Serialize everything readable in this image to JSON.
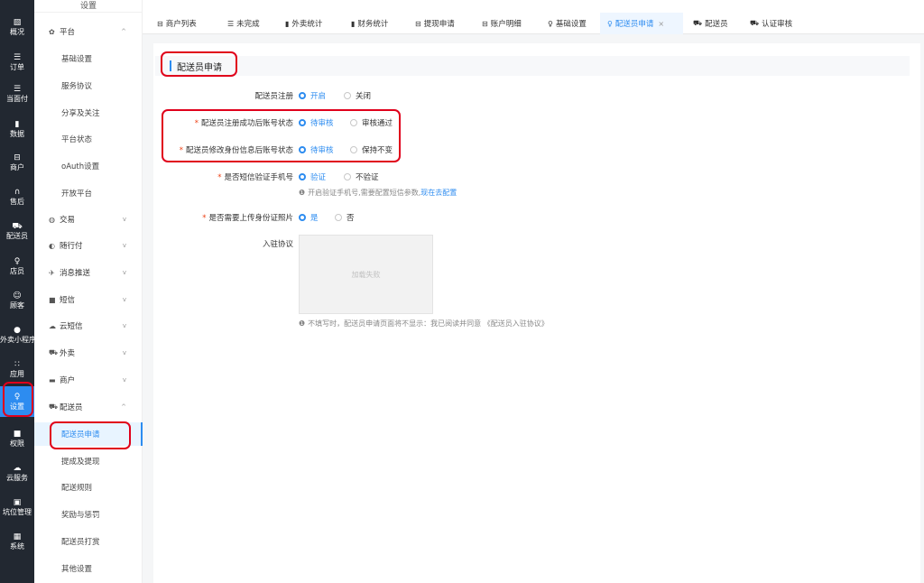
{
  "rail": [
    {
      "icon": "▧",
      "label": "概况"
    },
    {
      "icon": "☰",
      "label": "订单"
    },
    {
      "icon": "☰",
      "label": "当面付"
    },
    {
      "icon": "▮",
      "label": "数据"
    },
    {
      "icon": "⊟",
      "label": "商户"
    },
    {
      "icon": "∩",
      "label": "售后"
    },
    {
      "icon": "⛟",
      "label": "配送员"
    },
    {
      "icon": "♀",
      "label": "店员"
    },
    {
      "icon": "☺",
      "label": "顾客"
    },
    {
      "icon": "●",
      "label": "外卖小程序"
    },
    {
      "icon": "∷",
      "label": "应用"
    },
    {
      "icon": "♀",
      "label": "设置"
    },
    {
      "icon": "■",
      "label": "权限"
    },
    {
      "icon": "☁",
      "label": "云服务"
    },
    {
      "icon": "▣",
      "label": "坑位管理"
    },
    {
      "icon": "▦",
      "label": "系统"
    }
  ],
  "submenu": {
    "header": "设置",
    "groups": [
      {
        "icon": "✿",
        "label": "平台",
        "chev": "^"
      },
      {
        "label": "基础设置"
      },
      {
        "label": "服务协议"
      },
      {
        "label": "分享及关注"
      },
      {
        "label": "平台状态"
      },
      {
        "label": "oAuth设置"
      },
      {
        "label": "开放平台"
      },
      {
        "icon": "◍",
        "label": "交易",
        "chev": "v"
      },
      {
        "icon": "◐",
        "label": "随行付",
        "chev": "v"
      },
      {
        "icon": "✈",
        "label": "消息推送",
        "chev": "v"
      },
      {
        "icon": "■",
        "label": "短信",
        "chev": "v"
      },
      {
        "icon": "☁",
        "label": "云短信",
        "chev": "v"
      },
      {
        "icon": "⛟",
        "label": "外卖",
        "chev": "v"
      },
      {
        "icon": "▬",
        "label": "商户",
        "chev": "v"
      },
      {
        "icon": "⛟",
        "label": "配送员",
        "chev": "^"
      },
      {
        "label": "配送员申请"
      },
      {
        "label": "提成及提现"
      },
      {
        "label": "配送规则"
      },
      {
        "label": "奖励与惩罚"
      },
      {
        "label": "配送员打赏"
      },
      {
        "label": "其他设置"
      }
    ]
  },
  "tabs": [
    {
      "icon": "⊟",
      "label": "商户列表"
    },
    {
      "icon": "☰",
      "label": "未完成"
    },
    {
      "icon": "▮",
      "label": "外卖统计"
    },
    {
      "icon": "▮",
      "label": "财务统计"
    },
    {
      "icon": "⊟",
      "label": "提现申请"
    },
    {
      "icon": "⊟",
      "label": "账户明细"
    },
    {
      "icon": "♀",
      "label": "基础设置"
    },
    {
      "icon": "♀",
      "label": "配送员申请",
      "close": "×"
    },
    {
      "icon": "⛟",
      "label": "配送员"
    },
    {
      "icon": "⛟",
      "label": "认证审核"
    }
  ],
  "section_title": "配送员申请",
  "form": {
    "reg": {
      "label": "配送员注册",
      "options": [
        "开启",
        "关闭"
      ],
      "selected": 0
    },
    "reg_status": {
      "required": "*",
      "label": "配送员注册成功后账号状态",
      "options": [
        "待审核",
        "审核通过"
      ],
      "selected": 0
    },
    "modify_status": {
      "required": "*",
      "label": "配送员修改身份信息后账号状态",
      "options": [
        "待审核",
        "保持不变"
      ],
      "selected": 0
    },
    "sms_verify": {
      "required": "*",
      "label": "是否短信验证手机号",
      "options": [
        "验证",
        "不验证"
      ],
      "selected": 0
    },
    "sms_hint": {
      "icon": "❶",
      "text": "开启验证手机号,需要配置短信参数,",
      "link": "现在去配置"
    },
    "id_photo": {
      "required": "*",
      "label": "是否需要上传身份证照片",
      "options": [
        "是",
        "否"
      ],
      "selected": 0
    },
    "agreement": {
      "label": "入驻协议",
      "image_text": "加载失败"
    },
    "agreement_hint": {
      "icon": "❶",
      "text": "不填写时，配送员申请页面将不显示：我已阅读并同意 《配送员入驻协议》"
    }
  },
  "colors": {
    "accent": "#2d8cf0",
    "rail_bg": "#222831",
    "annotation": "#e0001b"
  }
}
